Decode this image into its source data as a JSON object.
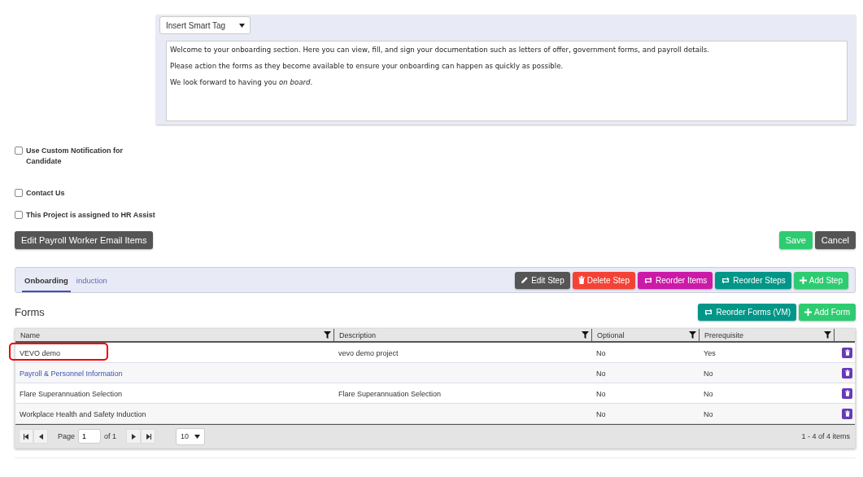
{
  "editor": {
    "dropdown": "Insert Smart Tag",
    "paragraphs": [
      "Welcome to your onboarding section. Here you can view, fill, and sign your documentation such as letters of offer, government forms, and payroll details.",
      "Please action the forms as they become available to ensure your onboarding can happen as quickly as possible.",
      "We look forward to having you *on board*."
    ]
  },
  "checkboxes": [
    {
      "label": "Use Custom Notification for Candidate",
      "checked": false
    },
    {
      "label": "Contact Us",
      "checked": false
    },
    {
      "label": "This Project is assigned to HR Assist",
      "checked": false
    }
  ],
  "email_button": "Edit Payroll Worker Email Items",
  "actions": [
    {
      "label": "Save",
      "kind": "success"
    },
    {
      "label": "Cancel",
      "kind": "dark"
    }
  ],
  "tabs": [
    {
      "label": "Onboarding",
      "selected": true
    },
    {
      "label": "induction",
      "selected": false
    }
  ],
  "step_buttons": [
    {
      "label": "Edit Step",
      "kind": "dark"
    },
    {
      "label": "Delete Step",
      "kind": "danger"
    },
    {
      "label": "Reorder Items",
      "kind": "magenta"
    },
    {
      "label": "Reorder Steps",
      "kind": "teal"
    },
    {
      "label": "Add Step",
      "kind": "success"
    }
  ],
  "forms": {
    "title": "Forms",
    "buttons": [
      {
        "label": "Reorder Forms (VM)",
        "kind": "teal"
      },
      {
        "label": "Add Form",
        "kind": "success"
      }
    ],
    "columns": [
      "Name",
      "Description",
      "Optional",
      "Prerequisite"
    ],
    "rows": [
      {
        "cells": [
          "VEVO demo",
          "vevo demo project",
          "No",
          "Yes"
        ],
        "highlighted": true,
        "link": false
      },
      {
        "cells": [
          "Payroll & Personnel Information",
          "",
          "No",
          "No"
        ],
        "highlighted": false,
        "link": true
      },
      {
        "cells": [
          "Flare Superannuation Selection",
          "Flare Superannuation Selection",
          "No",
          "No"
        ],
        "highlighted": false,
        "link": false
      },
      {
        "cells": [
          "Workplace Health and Safety Induction",
          "",
          "No",
          "No"
        ],
        "highlighted": false,
        "link": false
      }
    ],
    "pager": {
      "page_label": "Page",
      "page": "1",
      "of": "of 1",
      "page_size": "10",
      "summary": "1 - 4 of 4 items"
    }
  }
}
